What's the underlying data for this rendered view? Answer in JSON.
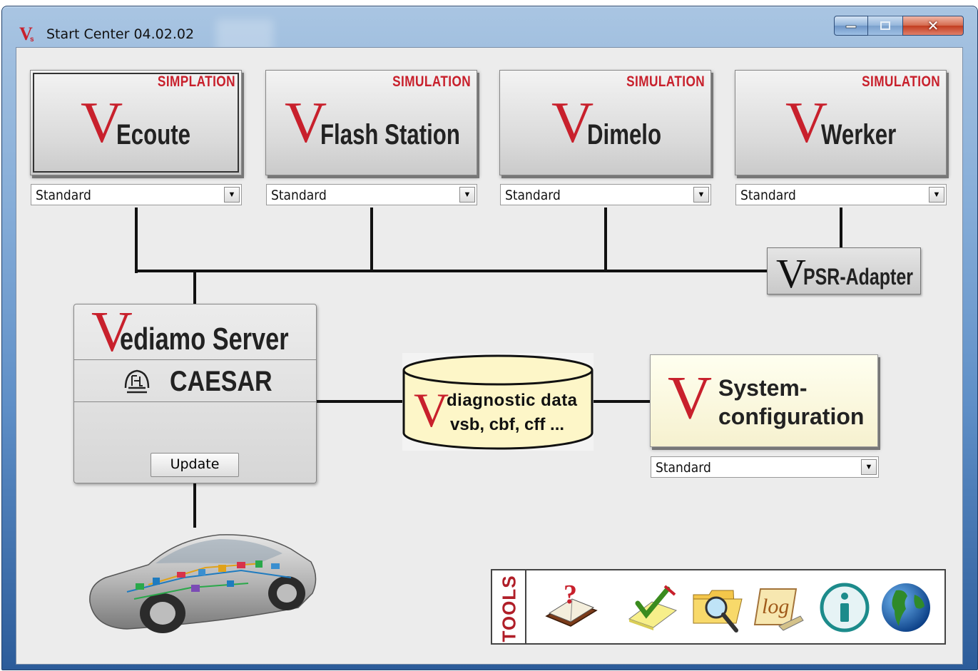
{
  "window": {
    "title": "Start Center 04.02.02"
  },
  "apps": [
    {
      "id": "ecoute",
      "tag": "SIMPLATION",
      "name": "Ecoute",
      "mode": "Standard"
    },
    {
      "id": "flash",
      "tag": "SIMULATION",
      "name": "Flash Station",
      "mode": "Standard"
    },
    {
      "id": "dimelo",
      "tag": "SIMULATION",
      "name": "Dimelo",
      "mode": "Standard"
    },
    {
      "id": "werker",
      "tag": "SIMULATION",
      "name": "Werker",
      "mode": "Standard"
    }
  ],
  "psr": {
    "v": "V",
    "label": "PSR-Adapter"
  },
  "server": {
    "v": "V",
    "name": "ediamo Server",
    "caesar": "CAESAR",
    "update_label": "Update"
  },
  "data_store": {
    "v": "V",
    "line1": "diagnostic data",
    "line2": "vsb, cbf, cff ..."
  },
  "system_config": {
    "v": "V",
    "line1": "System-",
    "line2": "configuration",
    "mode": "Standard"
  },
  "tools": {
    "label": "TOOLS"
  },
  "icons": {
    "app": "vediamo-logo-icon",
    "tools": [
      "help-book-icon",
      "check-notepad-icon",
      "folder-search-icon",
      "log-icon",
      "info-icon",
      "globe-icon"
    ]
  },
  "colors": {
    "brand_red": "#c8202c",
    "sysconf_bg": "#f6f1cf",
    "client_bg": "#ececec"
  }
}
